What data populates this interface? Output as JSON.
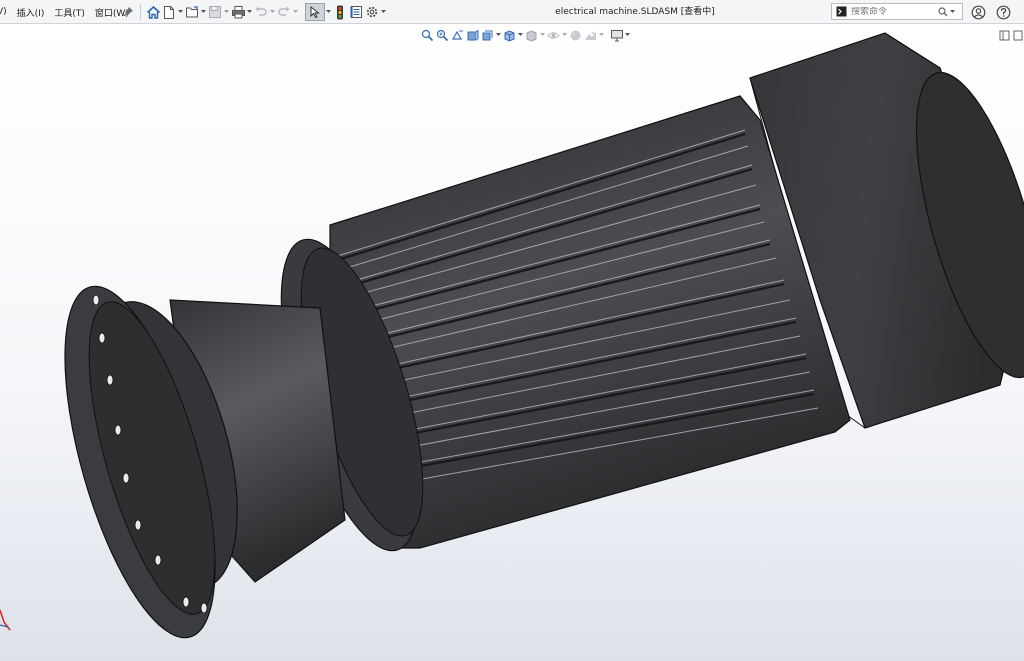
{
  "menu": {
    "items": [
      {
        "label": "V)"
      },
      {
        "label": "插入(I)"
      },
      {
        "label": "工具(T)"
      },
      {
        "label": "窗口(W)"
      }
    ]
  },
  "document": {
    "title": "electrical machine.SLDASM [查看中]"
  },
  "search": {
    "placeholder": "搜索命令"
  },
  "icons": {
    "pin": "pin-icon",
    "home": "home-icon",
    "new": "new-document-icon",
    "open": "open-folder-icon",
    "save": "save-icon",
    "print": "print-icon",
    "undo": "undo-icon",
    "redo": "redo-icon",
    "select": "select-arrow-icon",
    "traffic": "rebuild-traffic-light-icon",
    "file_props": "file-properties-icon",
    "options": "gear-icon",
    "user": "user-icon",
    "help": "help-icon"
  },
  "colors": {
    "background_top": "#ffffff",
    "background_bottom": "#dfe3ea",
    "model_dark": "#2e2f31",
    "model_mid": "#4a4b4e",
    "model_light": "#6a6b6e",
    "accent_red": "#d6261e"
  }
}
